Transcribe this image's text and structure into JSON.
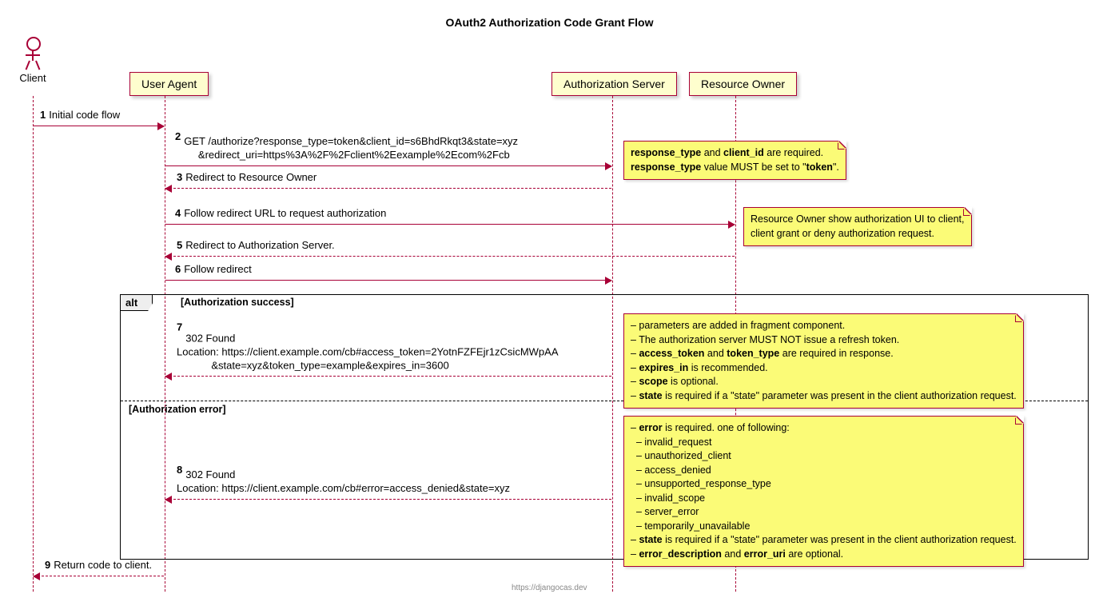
{
  "title": "OAuth2 Authorization Code Grant Flow",
  "participants": {
    "client": "Client",
    "user_agent": "User Agent",
    "auth_server": "Authorization Server",
    "resource_owner": "Resource Owner"
  },
  "messages": {
    "m1": {
      "num": "1",
      "text": "Initial code flow"
    },
    "m2": {
      "num": "2",
      "line1": "GET /authorize?response_type=token&client_id=s6BhdRkqt3&state=xyz",
      "line2": "        &redirect_uri=https%3A%2F%2Fclient%2Eexample%2Ecom%2Fcb"
    },
    "m3": {
      "num": "3",
      "text": "Redirect to Resource Owner"
    },
    "m4": {
      "num": "4",
      "text": "Follow redirect URL to request authorization"
    },
    "m5": {
      "num": "5",
      "text": "Redirect to Authorization Server."
    },
    "m6": {
      "num": "6",
      "text": "Follow redirect"
    },
    "m7": {
      "num": "7",
      "line1": "302 Found",
      "line2": "Location: https://client.example.com/cb#access_token=2YotnFZFEjr1zCsicMWpAA",
      "line3": "            &state=xyz&token_type=example&expires_in=3600"
    },
    "m8": {
      "num": "8",
      "line1": "302 Found",
      "line2": "Location: https://client.example.com/cb#error=access_denied&state=xyz"
    },
    "m9": {
      "num": "9",
      "text": "Return code to client."
    }
  },
  "notes": {
    "n1_html": "<b>response_type</b> and <b>client_id</b> are required.<br><b>response_type</b> value MUST be set to \"<b>token</b>\".",
    "n2_html": "Resource Owner show authorization UI to client,<br>client grant or deny authorization request.",
    "n3_html": "– parameters are added in fragment component.<br>– The authorization server MUST NOT issue a refresh token.<br>– <b>access_token</b> and <b>token_type</b> are required in response.<br>– <b>expires_in</b> is recommended.<br>– <b>scope</b> is optional.<br>– <b>state</b> is required if a \"state\" parameter was present in the client authorization request.",
    "n4_html": "– <b>error</b> is required. one of following:<br>&nbsp;&nbsp;– invalid_request<br>&nbsp;&nbsp;– unauthorized_client<br>&nbsp;&nbsp;– access_denied<br>&nbsp;&nbsp;– unsupported_response_type<br>&nbsp;&nbsp;– invalid_scope<br>&nbsp;&nbsp;– server_error<br>&nbsp;&nbsp;– temporarily_unavailable<br>– <b>state</b> is required if a \"state\" parameter was present in the client authorization request.<br>– <b>error_description</b> and <b>error_uri</b> are optional."
  },
  "alt": {
    "label": "alt",
    "cond1": "[Authorization success]",
    "cond2": "[Authorization error]"
  },
  "footer": "https://djangocas.dev"
}
